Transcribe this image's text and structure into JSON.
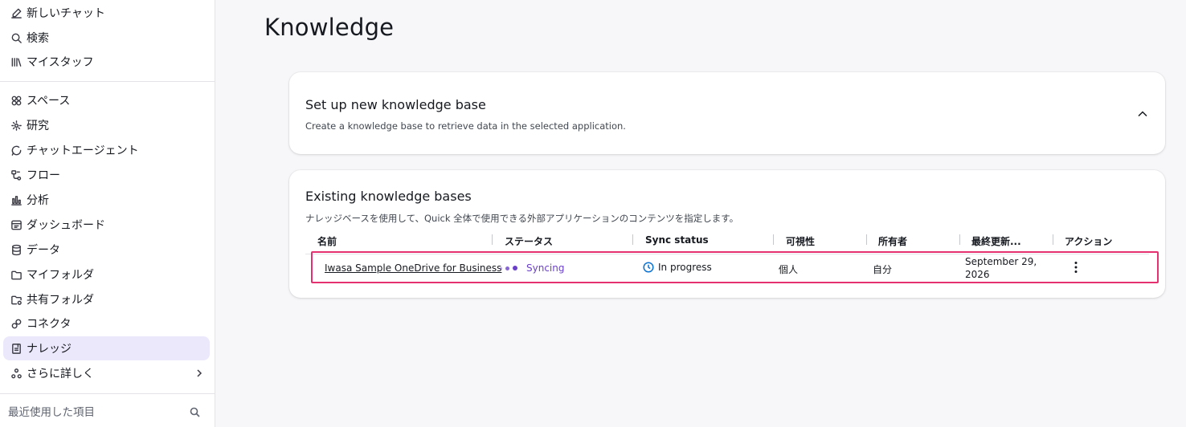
{
  "sidebar": {
    "top_items": [
      {
        "label": "新しいチャット",
        "icon": "edit-icon"
      },
      {
        "label": "検索",
        "icon": "search-icon"
      },
      {
        "label": "マイスタッフ",
        "icon": "library-icon"
      }
    ],
    "items": [
      {
        "label": "スペース",
        "icon": "spaces-icon"
      },
      {
        "label": "研究",
        "icon": "research-icon"
      },
      {
        "label": "チャットエージェント",
        "icon": "chat-agent-icon"
      },
      {
        "label": "フロー",
        "icon": "flow-icon"
      },
      {
        "label": "分析",
        "icon": "analytics-icon"
      },
      {
        "label": "ダッシュボード",
        "icon": "dashboard-icon"
      },
      {
        "label": "データ",
        "icon": "database-icon"
      },
      {
        "label": "マイフォルダ",
        "icon": "folder-icon"
      },
      {
        "label": "共有フォルダ",
        "icon": "shared-folder-icon"
      },
      {
        "label": "コネクタ",
        "icon": "connector-icon"
      },
      {
        "label": "ナレッジ",
        "icon": "knowledge-icon",
        "active": true
      },
      {
        "label": "さらに詳しく",
        "icon": "more-icon"
      }
    ],
    "recent_label": "最近使用した項目"
  },
  "main": {
    "title": "Knowledge",
    "setup_card": {
      "title": "Set up new knowledge base",
      "description": "Create a knowledge base to retrieve data in the selected application."
    },
    "existing_card": {
      "title": "Existing knowledge bases",
      "description": "ナレッジベースを使用して、Quick 全体で使用できる外部アプリケーションのコンテンツを指定します。",
      "columns": [
        "名前",
        "ステータス",
        "Sync status",
        "可視性",
        "所有者",
        "最終更新...",
        "アクション"
      ],
      "rows": [
        {
          "name": "Iwasa Sample OneDrive for Business",
          "status": "Syncing",
          "sync_status": "In progress",
          "visibility": "個人",
          "owner": "自分",
          "last_updated_line1": "September 29,",
          "last_updated_line2": "2026"
        }
      ]
    }
  },
  "colors": {
    "accent": "#6a40c9",
    "active_nav_bg": "#ebe8fb",
    "highlight_border": "#e5316f",
    "progress_icon": "#0972d3"
  }
}
